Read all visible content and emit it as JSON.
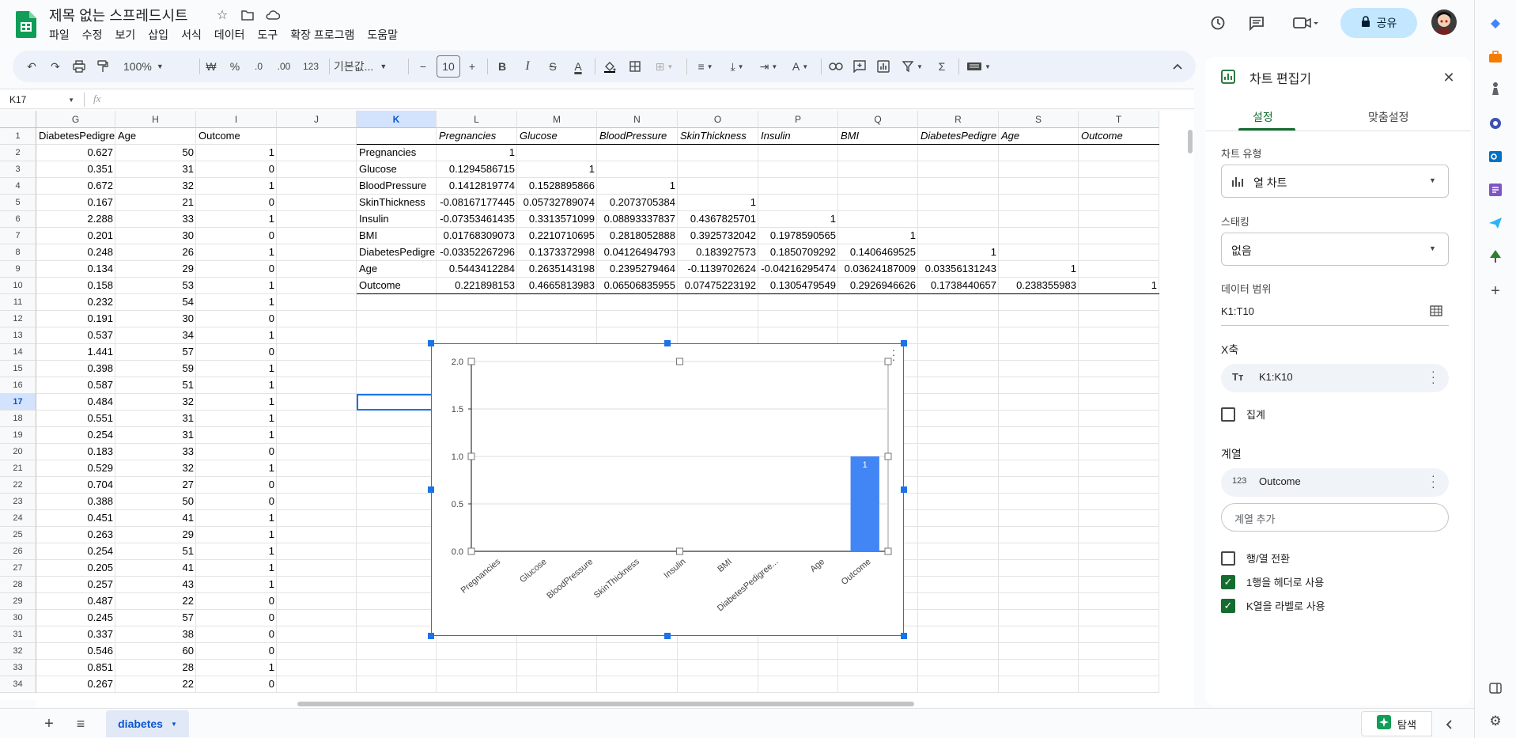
{
  "app": {
    "title": "제목 없는 스프레드시트",
    "menu": [
      "파일",
      "수정",
      "보기",
      "삽입",
      "서식",
      "데이터",
      "도구",
      "확장 프로그램",
      "도움말"
    ],
    "share_label": "공유"
  },
  "toolbar": {
    "zoom": "100%",
    "currency": "₩",
    "percent": "%",
    "dec_decrease": ".0",
    "dec_increase": ".00",
    "number_format": "123",
    "font": "기본값...",
    "font_size": "10",
    "bold": "B",
    "italic": "I",
    "strike": "S",
    "text_color": "A",
    "sum": "Σ"
  },
  "formula_bar": {
    "name_box": "K17",
    "fx": "fx",
    "value": ""
  },
  "sheet": {
    "columns": [
      "G",
      "H",
      "I",
      "J",
      "K",
      "L",
      "M",
      "N",
      "O",
      "P",
      "Q",
      "R",
      "S",
      "T"
    ],
    "rows": [
      "1",
      "2",
      "3",
      "4",
      "5",
      "6",
      "7",
      "8",
      "9",
      "10",
      "11",
      "12",
      "13",
      "14",
      "15",
      "16",
      "17",
      "18",
      "19",
      "20",
      "21",
      "22",
      "23",
      "24",
      "25",
      "26",
      "27",
      "28",
      "29",
      "30",
      "31",
      "32",
      "33",
      "34"
    ],
    "gh_header": [
      "DiabetesPedigre",
      "Age",
      "Outcome"
    ],
    "ghi": [
      [
        "0.627",
        "50",
        "1"
      ],
      [
        "0.351",
        "31",
        "0"
      ],
      [
        "0.672",
        "32",
        "1"
      ],
      [
        "0.167",
        "21",
        "0"
      ],
      [
        "2.288",
        "33",
        "1"
      ],
      [
        "0.201",
        "30",
        "0"
      ],
      [
        "0.248",
        "26",
        "1"
      ],
      [
        "0.134",
        "29",
        "0"
      ],
      [
        "0.158",
        "53",
        "1"
      ],
      [
        "0.232",
        "54",
        "1"
      ],
      [
        "0.191",
        "30",
        "0"
      ],
      [
        "0.537",
        "34",
        "1"
      ],
      [
        "1.441",
        "57",
        "0"
      ],
      [
        "0.398",
        "59",
        "1"
      ],
      [
        "0.587",
        "51",
        "1"
      ],
      [
        "0.484",
        "32",
        "1"
      ],
      [
        "0.551",
        "31",
        "1"
      ],
      [
        "0.254",
        "31",
        "1"
      ],
      [
        "0.183",
        "33",
        "0"
      ],
      [
        "0.529",
        "32",
        "1"
      ],
      [
        "0.704",
        "27",
        "0"
      ],
      [
        "0.388",
        "50",
        "0"
      ],
      [
        "0.451",
        "41",
        "1"
      ],
      [
        "0.263",
        "29",
        "1"
      ],
      [
        "0.254",
        "51",
        "1"
      ],
      [
        "0.205",
        "41",
        "1"
      ],
      [
        "0.257",
        "43",
        "1"
      ],
      [
        "0.487",
        "22",
        "0"
      ],
      [
        "0.245",
        "57",
        "0"
      ],
      [
        "0.337",
        "38",
        "0"
      ],
      [
        "0.546",
        "60",
        "0"
      ],
      [
        "0.851",
        "28",
        "1"
      ],
      [
        "0.267",
        "22",
        "0"
      ]
    ],
    "corr_header": [
      "Pregnancies",
      "Glucose",
      "BloodPressure",
      "SkinThickness",
      "Insulin",
      "BMI",
      "DiabetesPedigre",
      "Age",
      "Outcome"
    ],
    "corr_labels": [
      "Pregnancies",
      "Glucose",
      "BloodPressure",
      "SkinThickness",
      "Insulin",
      "BMI",
      "DiabetesPedigre",
      "Age",
      "Outcome"
    ],
    "corr": [
      [
        "1",
        "",
        "",
        "",
        "",
        "",
        "",
        "",
        ""
      ],
      [
        "0.1294586715",
        "1",
        "",
        "",
        "",
        "",
        "",
        "",
        ""
      ],
      [
        "0.1412819774",
        "0.1528895866",
        "1",
        "",
        "",
        "",
        "",
        "",
        ""
      ],
      [
        "-0.08167177445",
        "0.05732789074",
        "0.2073705384",
        "1",
        "",
        "",
        "",
        "",
        ""
      ],
      [
        "-0.07353461435",
        "0.3313571099",
        "0.08893337837",
        "0.4367825701",
        "1",
        "",
        "",
        "",
        ""
      ],
      [
        "0.01768309073",
        "0.2210710695",
        "0.2818052888",
        "0.3925732042",
        "0.1978590565",
        "1",
        "",
        "",
        ""
      ],
      [
        "-0.03352267296",
        "0.1373372998",
        "0.04126494793",
        "0.183927573",
        "0.1850709292",
        "0.1406469525",
        "1",
        "",
        ""
      ],
      [
        "0.5443412284",
        "0.2635143198",
        "0.2395279464",
        "-0.1139702624",
        "-0.04216295474",
        "0.03624187009",
        "0.03356131243",
        "1",
        ""
      ],
      [
        "0.221898153",
        "0.4665813983",
        "0.06506835955",
        "0.07475223192",
        "0.1305479549",
        "0.2926946626",
        "0.1738440657",
        "0.238355983",
        "1"
      ]
    ],
    "tab_name": "diabetes",
    "explore_label": "탐색"
  },
  "chart_data": {
    "type": "bar",
    "title": "",
    "categories": [
      "Pregnancies",
      "Glucose",
      "BloodPressure",
      "SkinThickness",
      "Insulin",
      "BMI",
      "DiabetesPedigree...",
      "Age",
      "Outcome"
    ],
    "series": [
      {
        "name": "Outcome",
        "values": [
          null,
          null,
          null,
          null,
          null,
          null,
          null,
          null,
          1
        ]
      }
    ],
    "data_label": "1",
    "yticks": [
      "0.0",
      "0.5",
      "1.0",
      "1.5",
      "2.0"
    ],
    "ylim": [
      0,
      2
    ],
    "color": "#4285f4",
    "grid": true
  },
  "editor": {
    "title": "차트 편집기",
    "tab_setup": "설정",
    "tab_customize": "맞춤설정",
    "chart_type_label": "차트 유형",
    "chart_type_value": "열 차트",
    "stacking_label": "스태킹",
    "stacking_value": "없음",
    "range_label": "데이터 범위",
    "range_value": "K1:T10",
    "xaxis_label": "X축",
    "xaxis_value": "K1:K10",
    "aggregate_label": "집계",
    "series_label": "계열",
    "series_value": "Outcome",
    "add_series_placeholder": "계열 추가",
    "switch_label": "행/열 전환",
    "header_label": "1행을 헤더로 사용",
    "label_col": "K열을 라벨로 사용"
  }
}
